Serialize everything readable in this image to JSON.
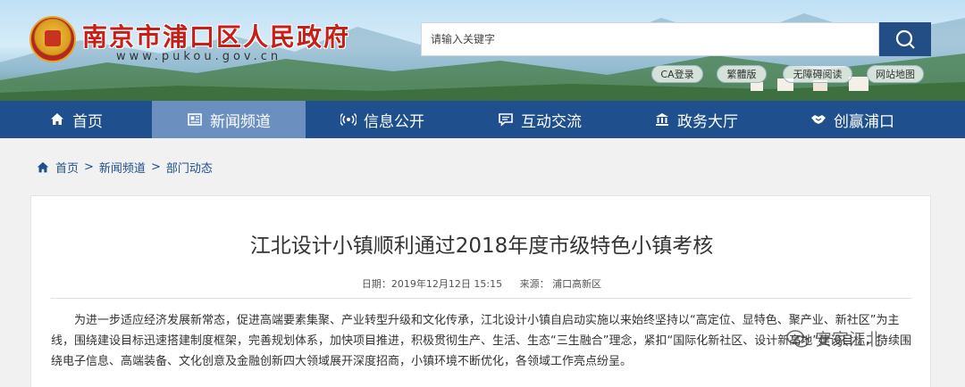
{
  "header": {
    "site_title": "南京市浦口区人民政府",
    "site_url": "www.pukou.gov.cn",
    "search_placeholder": "请输入关键字",
    "links": [
      "CA登录",
      "繁體版",
      "无障碍阅读",
      "网站地图"
    ]
  },
  "nav": {
    "items": [
      {
        "label": "首页",
        "icon": "home-icon"
      },
      {
        "label": "新闻频道",
        "icon": "newspaper-icon",
        "active": true
      },
      {
        "label": "信息公开",
        "icon": "broadcast-icon"
      },
      {
        "label": "互动交流",
        "icon": "chat-icon"
      },
      {
        "label": "政务大厅",
        "icon": "building-icon"
      },
      {
        "label": "创赢浦口",
        "icon": "handshake-icon"
      }
    ]
  },
  "breadcrumb": [
    "首页",
    "新闻频道",
    "部门动态"
  ],
  "article": {
    "title": "江北设计小镇顺利通过2018年度市级特色小镇考核",
    "date": "日期：2019年12月12日 15:15",
    "source": "来源：  浦口高新区",
    "body": "为进一步适应经济发展新常态，促进高端要素集聚、产业转型升级和文化传承，江北设计小镇自启动实施以来始终坚持以“高定位、显特色、聚产业、新社区”为主线，围绕建设目标迅速搭建制度框架，完善规划体系，加快项目推进，积极贯彻生产、生活、生态“三生融合”理念，紧扣“国际化新社区、设计新高地”建设目标，持续围绕电子信息、高端装备、文化创意及金融创新四大领域展开深度招商，小镇环境不断优化，各领域工作亮点纷呈。"
  },
  "watermark": "安家江北",
  "colors": {
    "nav_bg": "#1f4f8c",
    "nav_active": "#6b8fbe",
    "title_red": "#c81e18"
  }
}
